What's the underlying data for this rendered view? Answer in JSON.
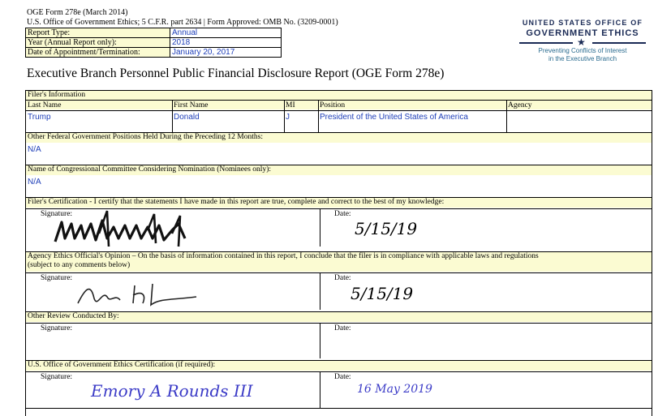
{
  "header": {
    "form_id": "OGE Form 278e (March 2014)",
    "office_line": "U.S. Office of Government Ethics; 5 C.F.R. part 2634 | Form Approved: OMB No. (3209-0001)",
    "meta": [
      {
        "label": "Report Type:",
        "value": "Annual"
      },
      {
        "label": "Year (Annual Report only):",
        "value": "2018"
      },
      {
        "label": "Date of Appointment/Termination:",
        "value": "January 20, 2017"
      }
    ]
  },
  "logo": {
    "line1": "UNITED STATES OFFICE OF",
    "line2": "GOVERNMENT ETHICS",
    "tagline1": "Preventing Conflicts of Interest",
    "tagline2": "in the Executive Branch"
  },
  "title": "Executive Branch Personnel Public Financial Disclosure Report (OGE Form 278e)",
  "filer": {
    "section": "Filer's Information",
    "columns": [
      "Last Name",
      "First Name",
      "MI",
      "Position",
      "Agency"
    ],
    "values": [
      "Trump",
      "Donald",
      "J",
      "President of the United States of America",
      ""
    ]
  },
  "other_positions": {
    "label": "Other Federal Government Positions Held During the Preceding 12 Months:",
    "value": "N/A"
  },
  "committee": {
    "label": "Name of Congressional Committee Considering Nomination (Nominees only):",
    "value": "N/A"
  },
  "certification": {
    "label": "Filer's Certification - I certify that the statements I have made in this report are true, complete and correct to the best of my knowledge:",
    "signature_label": "Signature:",
    "date_label": "Date:",
    "date_value": "5/15/19"
  },
  "agency_opinion": {
    "label": "Agency Ethics Official's Opinion – On the basis of information contained in this report, I conclude that the filer is in compliance with applicable laws and regulations",
    "label2": "(subject to any comments below)",
    "signature_label": "Signature:",
    "date_label": "Date:",
    "date_value": "5/15/19"
  },
  "other_review": {
    "label": "Other Review Conducted By:",
    "signature_label": "Signature:",
    "date_label": "Date:"
  },
  "oge_cert": {
    "label": "U.S. Office of Government Ethics Certification (if required):",
    "signature_label": "Signature:",
    "date_label": "Date:",
    "date_value": "16 May 2019",
    "signature_text": "Emory A Rounds III"
  },
  "colors": {
    "band": "#fbfbd2",
    "value_blue": "#1f3fb8",
    "logo_navy": "#1a2a55"
  }
}
